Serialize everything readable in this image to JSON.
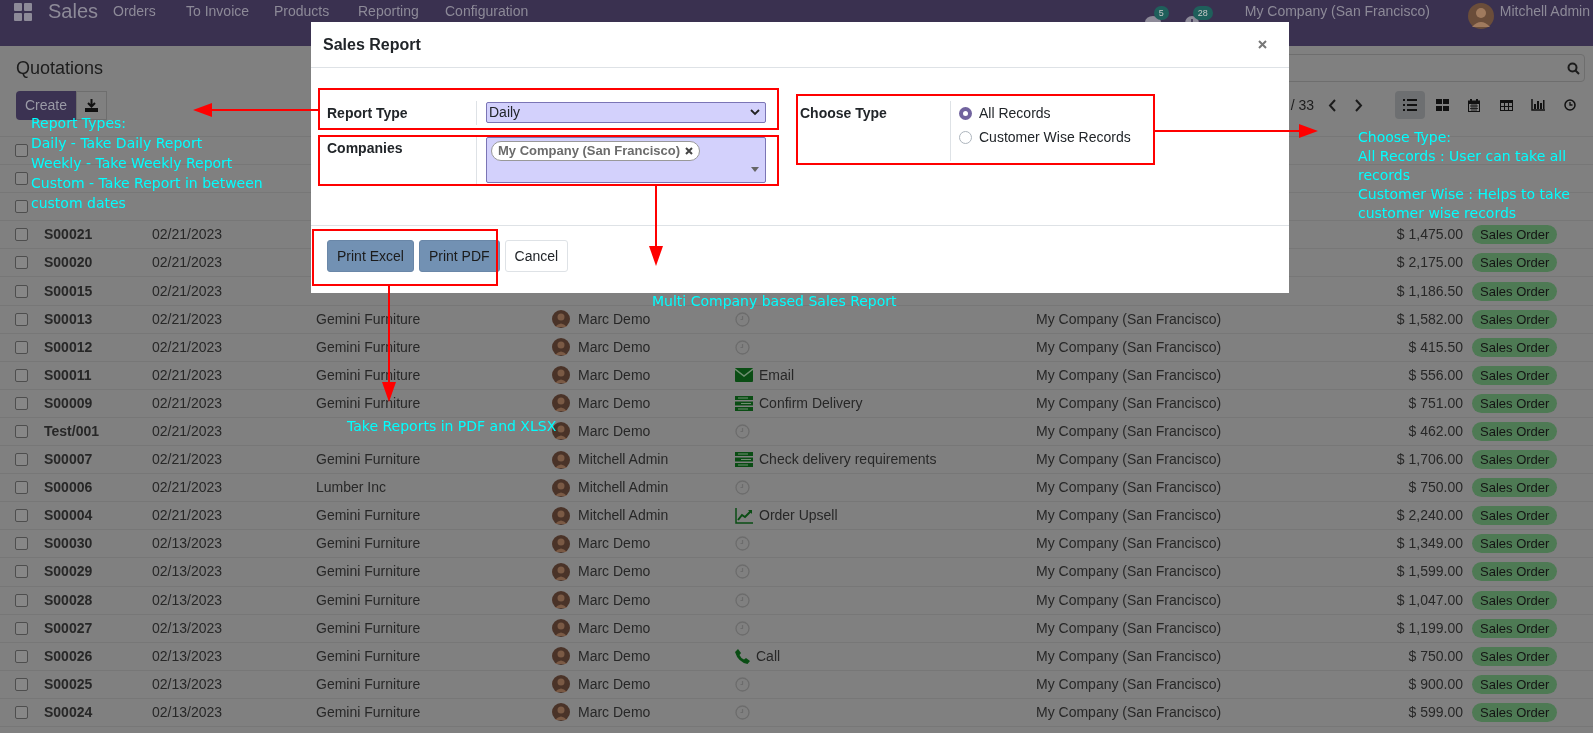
{
  "navbar": {
    "app_name": "Sales",
    "menus": [
      "Orders",
      "To Invoice",
      "Products",
      "Reporting",
      "Configuration"
    ],
    "chat_badge": "5",
    "activity_badge": "28",
    "company": "My Company (San Francisco)",
    "user": "Mitchell Admin"
  },
  "control_panel": {
    "title": "Quotations",
    "create_button": "Create",
    "pager": "/ 33",
    "views": [
      {
        "kind": "list",
        "selected": true
      },
      {
        "kind": "kanban",
        "selected": false
      },
      {
        "kind": "calendar",
        "selected": false
      },
      {
        "kind": "pivot",
        "selected": false
      },
      {
        "kind": "graph",
        "selected": false
      },
      {
        "kind": "activity",
        "selected": false
      }
    ]
  },
  "table": {
    "rows": [
      {
        "selected": false
      },
      {
        "selected": false
      },
      {
        "selected": false
      },
      {
        "selected": false,
        "number": "S00021",
        "date": "02/21/2023",
        "amount": "$ 1,475.00",
        "status": "Sales Order"
      },
      {
        "selected": false,
        "number": "S00020",
        "date": "02/21/2023",
        "amount": "$ 2,175.00",
        "status": "Sales Order"
      },
      {
        "selected": false,
        "number": "S00015",
        "date": "02/21/2023",
        "amount": "$ 1,186.50",
        "status": "Sales Order"
      },
      {
        "selected": false,
        "number": "S00013",
        "date": "02/21/2023",
        "customer": "Gemini Furniture",
        "salesperson": "Marc Demo",
        "activity": {
          "kind": "none"
        },
        "company": "My Company (San Francisco)",
        "amount": "$ 1,582.00",
        "status": "Sales Order"
      },
      {
        "selected": false,
        "number": "S00012",
        "date": "02/21/2023",
        "customer": "Gemini Furniture",
        "salesperson": "Marc Demo",
        "activity": {
          "kind": "none"
        },
        "company": "My Company (San Francisco)",
        "amount": "$ 415.50",
        "status": "Sales Order"
      },
      {
        "selected": false,
        "number": "S00011",
        "date": "02/21/2023",
        "customer": "Gemini Furniture",
        "salesperson": "Marc Demo",
        "activity": {
          "kind": "email",
          "label": "Email"
        },
        "company": "My Company (San Francisco)",
        "amount": "$ 556.00",
        "status": "Sales Order"
      },
      {
        "selected": false,
        "number": "S00009",
        "date": "02/21/2023",
        "customer": "Gemini Furniture",
        "salesperson": "Marc Demo",
        "activity": {
          "kind": "todo",
          "label": "Confirm Delivery"
        },
        "company": "My Company (San Francisco)",
        "amount": "$ 751.00",
        "status": "Sales Order"
      },
      {
        "selected": false,
        "number": "Test/001",
        "date": "02/21/2023",
        "salesperson": "Marc Demo",
        "activity": {
          "kind": "none"
        },
        "company": "My Company (San Francisco)",
        "amount": "$ 462.00",
        "status": "Sales Order"
      },
      {
        "selected": false,
        "number": "S00007",
        "date": "02/21/2023",
        "customer": "Gemini Furniture",
        "salesperson": "Mitchell Admin",
        "activity": {
          "kind": "todo",
          "label": "Check delivery requirements"
        },
        "company": "My Company (San Francisco)",
        "amount": "$ 1,706.00",
        "status": "Sales Order"
      },
      {
        "selected": false,
        "number": "S00006",
        "date": "02/21/2023",
        "customer": "Lumber Inc",
        "salesperson": "Mitchell Admin",
        "activity": {
          "kind": "none"
        },
        "company": "My Company (San Francisco)",
        "amount": "$ 750.00",
        "status": "Sales Order"
      },
      {
        "selected": false,
        "number": "S00004",
        "date": "02/21/2023",
        "customer": "Gemini Furniture",
        "salesperson": "Mitchell Admin",
        "activity": {
          "kind": "upsell",
          "label": "Order Upsell"
        },
        "company": "My Company (San Francisco)",
        "amount": "$ 2,240.00",
        "status": "Sales Order"
      },
      {
        "selected": false,
        "number": "S00030",
        "date": "02/13/2023",
        "customer": "Gemini Furniture",
        "salesperson": "Marc Demo",
        "activity": {
          "kind": "none"
        },
        "company": "My Company (San Francisco)",
        "amount": "$ 1,349.00",
        "status": "Sales Order"
      },
      {
        "selected": false,
        "number": "S00029",
        "date": "02/13/2023",
        "customer": "Gemini Furniture",
        "salesperson": "Marc Demo",
        "activity": {
          "kind": "none"
        },
        "company": "My Company (San Francisco)",
        "amount": "$ 1,599.00",
        "status": "Sales Order"
      },
      {
        "selected": false,
        "number": "S00028",
        "date": "02/13/2023",
        "customer": "Gemini Furniture",
        "salesperson": "Marc Demo",
        "activity": {
          "kind": "none"
        },
        "company": "My Company (San Francisco)",
        "amount": "$ 1,047.00",
        "status": "Sales Order"
      },
      {
        "selected": false,
        "number": "S00027",
        "date": "02/13/2023",
        "customer": "Gemini Furniture",
        "salesperson": "Marc Demo",
        "activity": {
          "kind": "none"
        },
        "company": "My Company (San Francisco)",
        "amount": "$ 1,199.00",
        "status": "Sales Order"
      },
      {
        "selected": false,
        "number": "S00026",
        "date": "02/13/2023",
        "customer": "Gemini Furniture",
        "salesperson": "Marc Demo",
        "activity": {
          "kind": "call",
          "label": "Call"
        },
        "company": "My Company (San Francisco)",
        "amount": "$ 750.00",
        "status": "Sales Order"
      },
      {
        "selected": false,
        "number": "S00025",
        "date": "02/13/2023",
        "customer": "Gemini Furniture",
        "salesperson": "Marc Demo",
        "activity": {
          "kind": "none"
        },
        "company": "My Company (San Francisco)",
        "amount": "$ 900.00",
        "status": "Sales Order"
      },
      {
        "selected": false,
        "number": "S00024",
        "date": "02/13/2023",
        "customer": "Gemini Furniture",
        "salesperson": "Marc Demo",
        "activity": {
          "kind": "none"
        },
        "company": "My Company (San Francisco)",
        "amount": "$ 599.00",
        "status": "Sales Order"
      }
    ]
  },
  "dialog": {
    "title": "Sales Report",
    "report_type": {
      "label": "Report Type",
      "value": "Daily"
    },
    "companies": {
      "label": "Companies",
      "tags": [
        "My Company (San Francisco)"
      ]
    },
    "choose_type": {
      "label": "Choose Type",
      "options": [
        {
          "label": "All Records",
          "selected": true
        },
        {
          "label": "Customer Wise Records",
          "selected": false
        }
      ]
    },
    "buttons": [
      {
        "label": "Print Excel",
        "kind": "primary"
      },
      {
        "label": "Print PDF",
        "kind": "primary"
      },
      {
        "label": "Cancel",
        "kind": "secondary"
      }
    ]
  },
  "annotations": {
    "report_types": [
      "Report Types:",
      "Daily - Take Daily Report",
      "Weekly - Take Weekly Report",
      "Custom - Take Report in between custom dates"
    ],
    "choose_type": [
      "Choose Type:",
      "All Records : User can take all records",
      "Customer Wise : Helps to take customer wise records"
    ],
    "multi_company": "Multi Company based Sales Report",
    "print": "Take Reports in PDF and XLSX"
  }
}
